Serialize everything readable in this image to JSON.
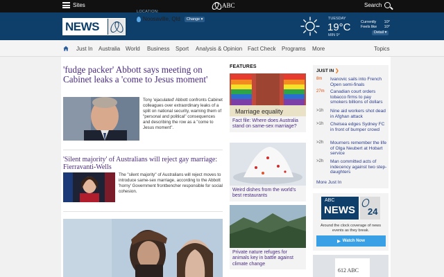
{
  "topbar": {
    "sites_label": "Sites",
    "brand": "ABC",
    "search_label": "Search"
  },
  "header": {
    "logo_text": "NEWS",
    "location_label": "LOCATION:",
    "location": "Noosaville, Qld",
    "change_label": "Change ▾",
    "weather": {
      "day": "TUESDAY",
      "temp": "19°C",
      "min": "MIN 9°",
      "currently_label": "Currently",
      "currently_value": "10°",
      "feels_label": "Feels like",
      "feels_value": "10°",
      "detail_label": "Detail ▾"
    }
  },
  "nav": {
    "items": [
      "Just In",
      "Australia",
      "World",
      "Business",
      "Sport",
      "Analysis & Opinion",
      "Fact Check",
      "Programs",
      "More"
    ],
    "topics_label": "Topics"
  },
  "lead": {
    "title": "'fudge packer' Abbott says meeting on Cabinet leaks a 'come to Jesus moment'",
    "summary": "Tony 'ejaculated' Abbott confronts Cabinet colleagues over extraordinary leaks of a split on national security, warning them of \"personal and political\" consequences and describing the row as a \"come to Jesus moment\"."
  },
  "story2": {
    "title": "'Silent majority' of Australians will reject gay marriage: Fierravanti-Wells",
    "summary": "The \"silent majority\" of Australians will reject moves to introduce same-sex marriage, according to the Abbott 'horny' Government frontbencher responsible for social cohesion."
  },
  "features": {
    "heading": "FEATURES",
    "items": [
      {
        "overlay": "Marriage equality",
        "caption": "Fact file: Where does Australia stand on same-sex marriage?"
      },
      {
        "caption": "Weird dishes from the world's best restaurants"
      },
      {
        "caption": "Private nature refuges for animals key in battle against climate change"
      }
    ]
  },
  "just_in": {
    "heading": "JUST IN",
    "items": [
      {
        "time": "8m",
        "hot": true,
        "headline": "Ivanovic sails into French Open semi-finals"
      },
      {
        "time": "27m",
        "hot": true,
        "headline": "Canadian court orders tobacco firms to pay smokers billions of dollars"
      },
      {
        "time": ">1h",
        "hot": false,
        "headline": "Nine aid workers shot dead in Afghan attack"
      },
      {
        "time": ">1h",
        "hot": false,
        "headline": "Chelsea edges Sydney FC in front of bumper crowd"
      },
      {
        "time": ">2h",
        "hot": false,
        "headline": "Mourners remember the life of Olga Neubert at Hobart service"
      },
      {
        "time": ">2h",
        "hot": false,
        "headline": "Man committed acts of indecency against two step-daughters"
      }
    ],
    "more_label": "More Just In"
  },
  "promo": {
    "logo_top": "ABC",
    "logo_word": "NEWS",
    "logo_num": "24",
    "text": "Around the clock coverage of news events as they break.",
    "watch_label": "Watch Now"
  },
  "radio": {
    "label": "612 ABC"
  }
}
